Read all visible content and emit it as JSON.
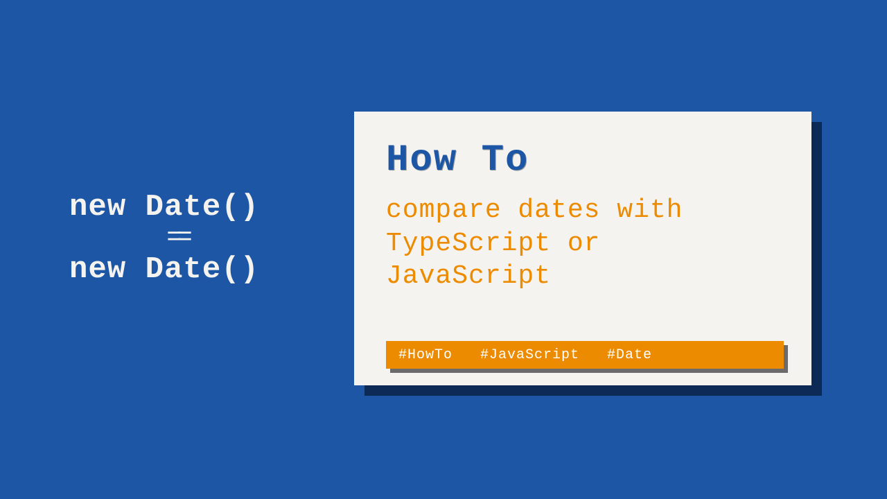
{
  "left": {
    "line1": "new Date()",
    "eq": "==",
    "line2": "new Date()"
  },
  "card": {
    "title": "How To",
    "subtitle": "compare dates with TypeScript or JavaScript",
    "tags": {
      "t1": "#HowTo",
      "t2": "#JavaScript",
      "t3": "#Date"
    }
  }
}
